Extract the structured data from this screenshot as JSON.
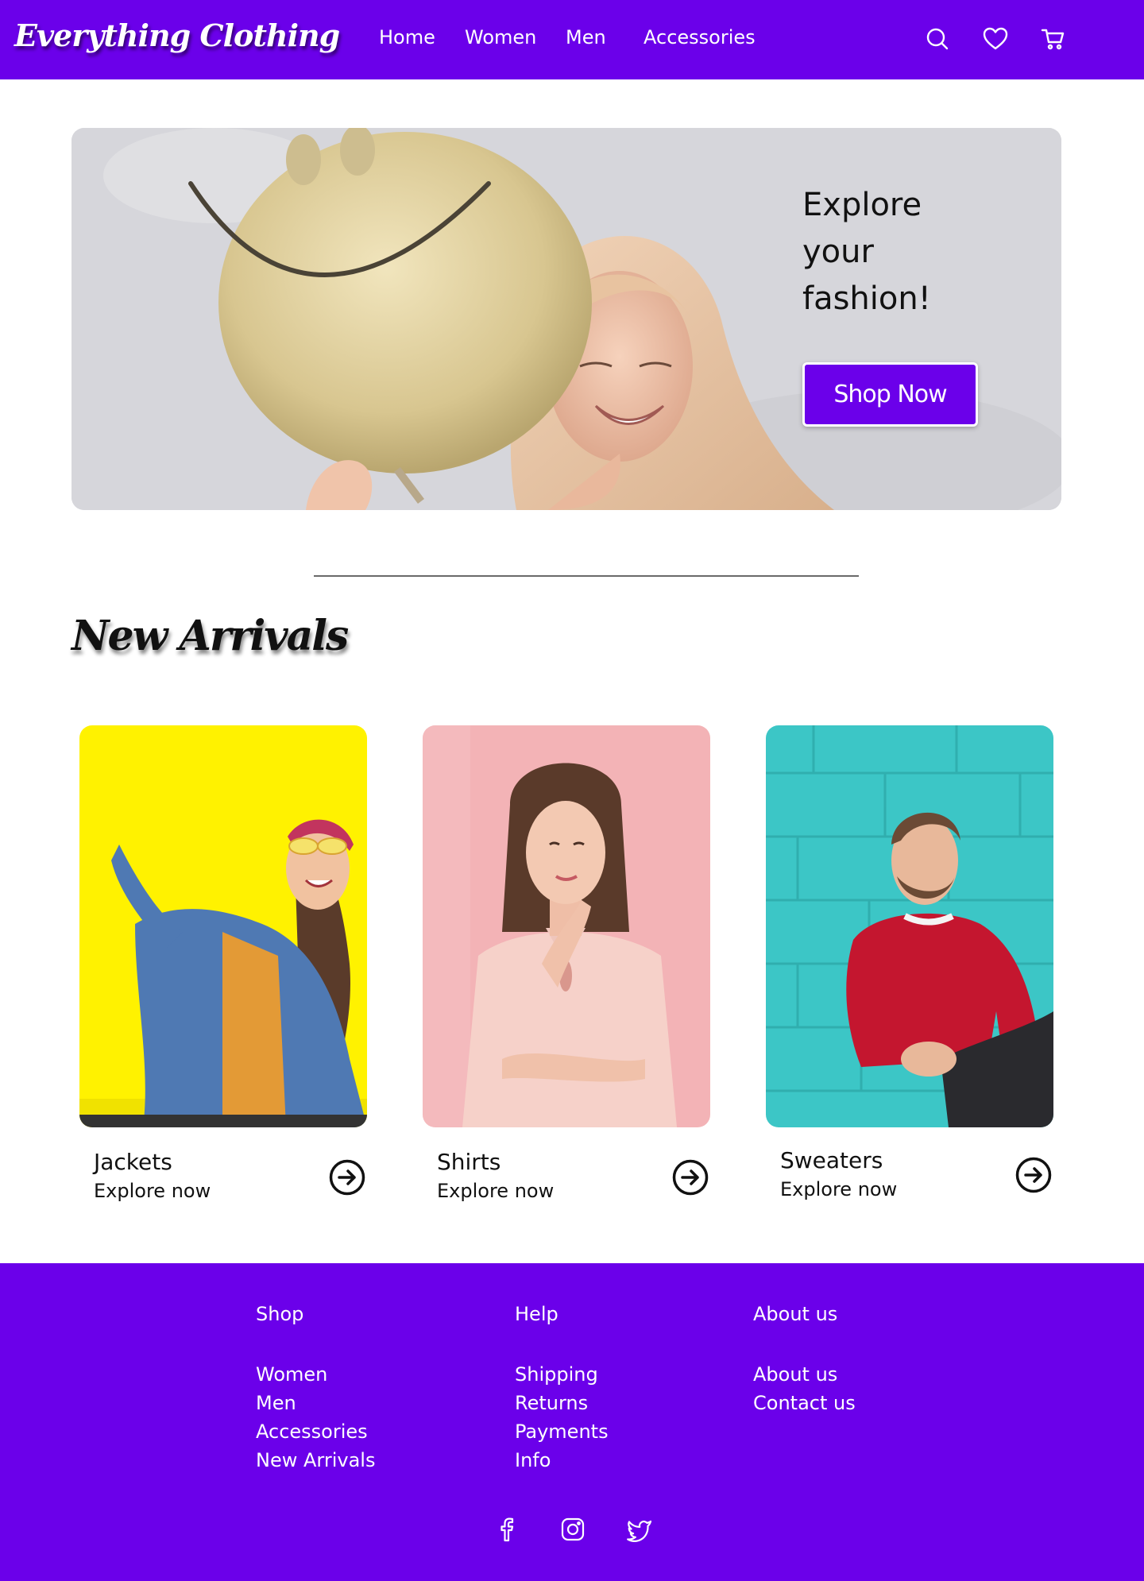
{
  "header": {
    "logo": "Everything Clothing",
    "nav": [
      "Home",
      "Women",
      "Men",
      "Accessories"
    ],
    "icons": [
      "search-icon",
      "heart-icon",
      "cart-icon"
    ],
    "brand_color": "#6b00ea"
  },
  "hero": {
    "title_lines": [
      "Explore",
      "your",
      "fashion!"
    ],
    "button_label": "Shop Now"
  },
  "section": {
    "title": "New Arrivals"
  },
  "cards": [
    {
      "title": "Jackets",
      "subtitle": "Explore now",
      "bg_color": "#fff200"
    },
    {
      "title": "Shirts",
      "subtitle": "Explore now",
      "bg_color": "#f3b3b6"
    },
    {
      "title": "Sweaters",
      "subtitle": "Explore now",
      "bg_color": "#3cc6c6"
    }
  ],
  "footer": {
    "columns": [
      {
        "heading": "Shop",
        "items": [
          "Women",
          "Men",
          "Accessories",
          "New Arrivals"
        ]
      },
      {
        "heading": "Help",
        "items": [
          "Shipping",
          "Returns",
          "Payments",
          "Info"
        ]
      },
      {
        "heading": "About us",
        "items": [
          "About us",
          "Contact us"
        ]
      }
    ],
    "social_icons": [
      "facebook-icon",
      "instagram-icon",
      "twitter-icon"
    ]
  }
}
